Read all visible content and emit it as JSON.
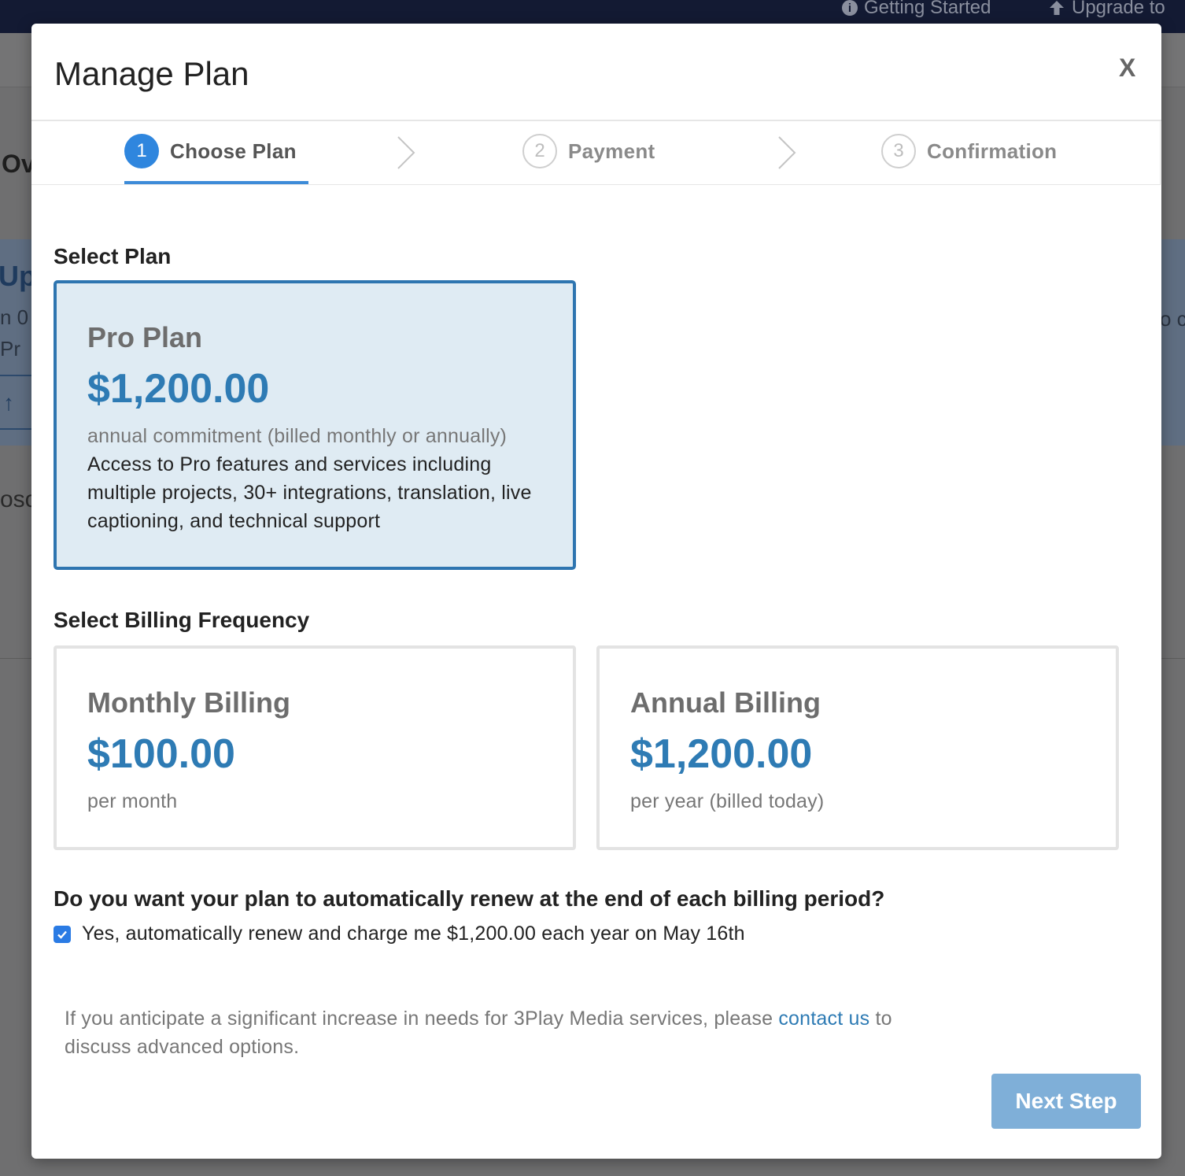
{
  "background": {
    "topbar": {
      "getting_started": "Getting Started",
      "upgrade": "Upgrade to"
    },
    "fragments": {
      "ov": "Ov",
      "upg": "Upg",
      "n0": "n 0",
      "pr": "Pr",
      "osc": "osc",
      "oc": "o c"
    }
  },
  "modal": {
    "title": "Manage Plan",
    "close_label": "X",
    "steps": [
      {
        "number": "1",
        "label": "Choose Plan",
        "active": true
      },
      {
        "number": "2",
        "label": "Payment",
        "active": false
      },
      {
        "number": "3",
        "label": "Confirmation",
        "active": false
      }
    ],
    "select_plan_heading": "Select Plan",
    "plan": {
      "name": "Pro Plan",
      "price": "$1,200.00",
      "commitment": "annual commitment (billed monthly or annually)",
      "description": "Access to Pro features and services including multiple projects, 30+ integrations, translation, live captioning, and technical support"
    },
    "billing_heading": "Select Billing Frequency",
    "billing_options": [
      {
        "name": "Monthly Billing",
        "price": "$100.00",
        "period": "per month"
      },
      {
        "name": "Annual Billing",
        "price": "$1,200.00",
        "period": "per year (billed today)"
      }
    ],
    "renew_question": "Do you want your plan to automatically renew at the end of each billing period?",
    "renew_checkbox": {
      "checked": true,
      "label": "Yes, automatically renew and charge me $1,200.00 each year on May 16th"
    },
    "note": {
      "before_link": "If you anticipate a significant increase in needs for 3Play Media services, please ",
      "link_text": "contact us",
      "after_link": " to discuss advanced options."
    },
    "next_button": "Next Step"
  },
  "colors": {
    "accent": "#2e7bb4",
    "step_active": "#2f86de",
    "selected_card_bg": "#dfebf3",
    "next_button_bg": "#7fafd8",
    "checkbox": "#2a7be4"
  },
  "icons": {
    "info": "info-circle-icon",
    "upgrade": "arrow-up-icon",
    "step_separator": "chevron-right-icon",
    "checkbox": "checkmark-icon"
  }
}
